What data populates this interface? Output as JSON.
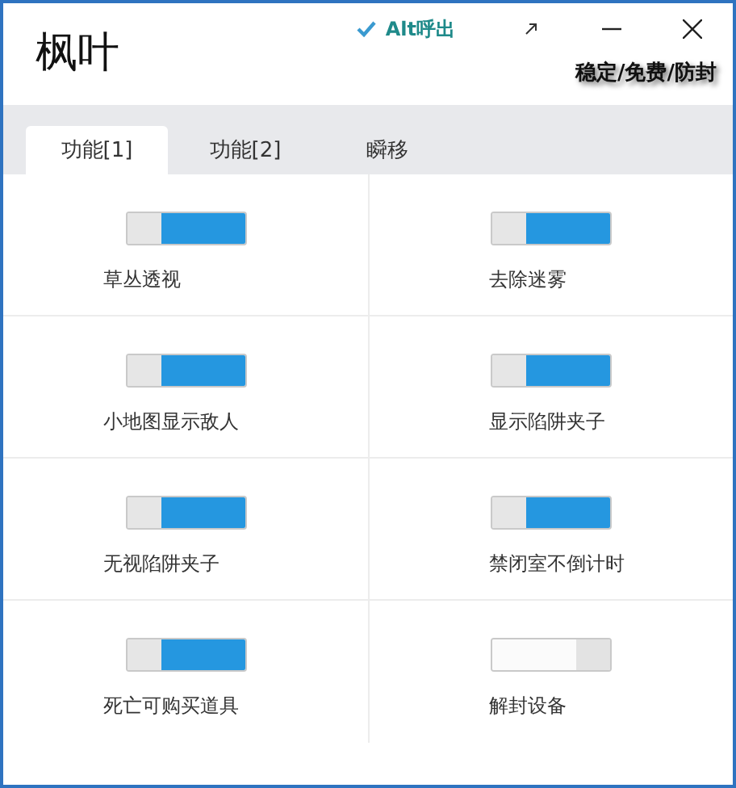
{
  "window": {
    "title": "枫叶",
    "hotkey_hint": "Alt呼出",
    "tagline": "稳定/免费/防封"
  },
  "tabs": [
    {
      "label": "功能[1]",
      "selected": true
    },
    {
      "label": "功能[2]",
      "selected": false
    },
    {
      "label": "瞬移",
      "selected": false
    }
  ],
  "features": [
    {
      "label": "草丛透视",
      "on": true
    },
    {
      "label": "去除迷雾",
      "on": true
    },
    {
      "label": "小地图显示敌人",
      "on": true
    },
    {
      "label": "显示陷阱夹子",
      "on": true
    },
    {
      "label": "无视陷阱夹子",
      "on": true
    },
    {
      "label": "禁闭室不倒计时",
      "on": true
    },
    {
      "label": "死亡可购买道具",
      "on": true
    },
    {
      "label": "解封设备",
      "on": false
    }
  ]
}
